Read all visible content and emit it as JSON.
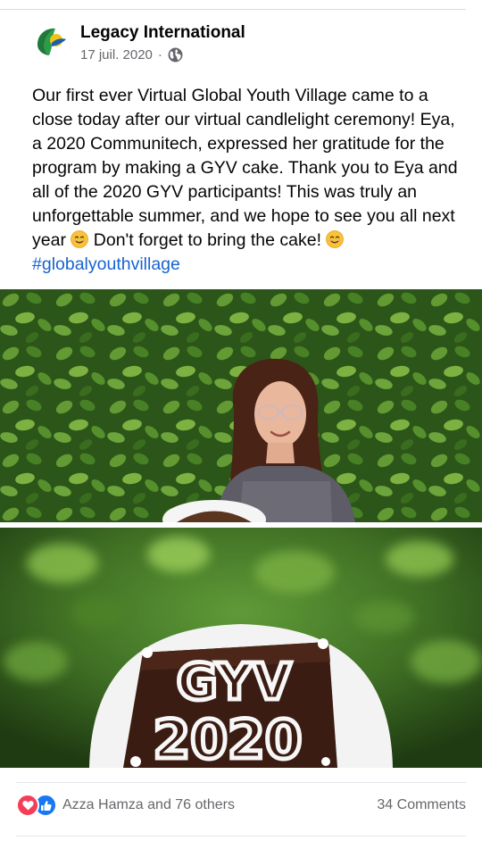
{
  "post": {
    "author": "Legacy International",
    "date": "17 juil. 2020",
    "separator": "·",
    "privacy_icon": "globe-icon",
    "text_lines": [
      "Our first ever Virtual Global Youth Village came to a close today after our virtual candlelight ceremony! Eya, a 2020 Communitech, expressed her gratitude for the program by making a GYV cake. Thank you to Eya and all of the 2020 GYV participants! This was truly an unforgettable summer, and we hope to see you all next year",
      "Don't forget to bring the cake!",
      "#globalyouthvillage"
    ],
    "emoji": "smiling-face-emoji",
    "hashtag_color": "#1763cf"
  },
  "photos": {
    "cake_text_line1": "GYV",
    "cake_text_line2": "2020"
  },
  "engagement": {
    "reaction_icons": [
      "love-icon",
      "like-icon"
    ],
    "reactions_text": "Azza Hamza and 76 others",
    "comments_text": "34 Comments"
  }
}
